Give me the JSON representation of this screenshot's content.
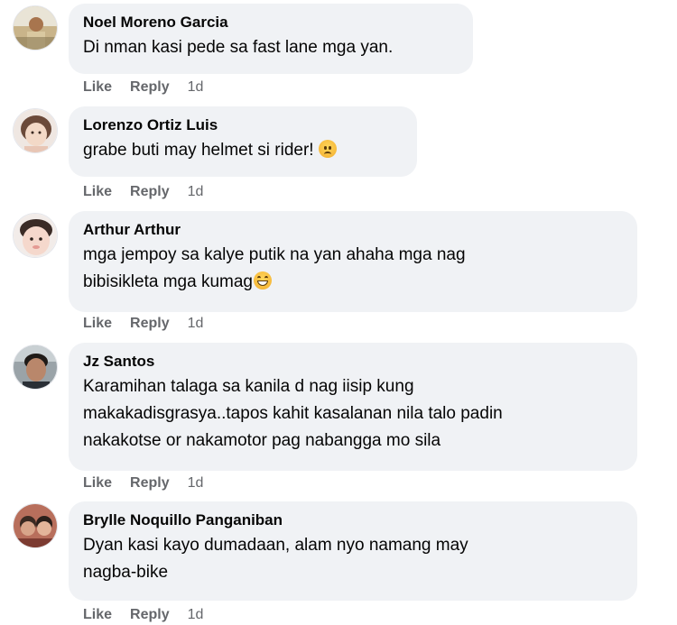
{
  "comments": [
    {
      "author": "Noel Moreno Garcia",
      "lines": [
        "Di nman kasi pede sa fast lane mga yan."
      ],
      "emoji": "",
      "like": "Like",
      "reply": "Reply",
      "time": "1d",
      "avatar_icon": "avatar-photo-icon"
    },
    {
      "author": "Lorenzo Ortiz Luis",
      "lines": [
        "grabe buti may helmet si rider!"
      ],
      "emoji": "sad-face-emoji",
      "like": "Like",
      "reply": "Reply",
      "time": "1d",
      "avatar_icon": "avatar-photo-icon"
    },
    {
      "author": "Arthur Arthur",
      "lines": [
        "mga jempoy sa kalye putik na yan ahaha mga nag",
        "bibisikleta mga kumag"
      ],
      "emoji": "grinning-face-emoji",
      "like": "Like",
      "reply": "Reply",
      "time": "1d",
      "avatar_icon": "avatar-photo-icon"
    },
    {
      "author": "Jz Santos",
      "lines": [
        "Karamihan talaga sa kanila d nag iisip kung",
        "makakadisgrasya..tapos kahit kasalanan nila talo padin",
        "nakakotse or nakamotor pag nabangga mo sila"
      ],
      "emoji": "",
      "like": "Like",
      "reply": "Reply",
      "time": "1d",
      "avatar_icon": "avatar-photo-icon"
    },
    {
      "author": "Brylle Noquillo Panganiban",
      "lines": [
        "Dyan kasi kayo dumadaan, alam nyo namang may",
        "nagba-bike"
      ],
      "emoji": "",
      "like": "Like",
      "reply": "Reply",
      "time": "1d",
      "avatar_icon": "avatar-photo-icon"
    }
  ],
  "colors": {
    "bubble_bg": "#f0f2f5",
    "action_text": "#65676b",
    "name_text": "#050505"
  }
}
